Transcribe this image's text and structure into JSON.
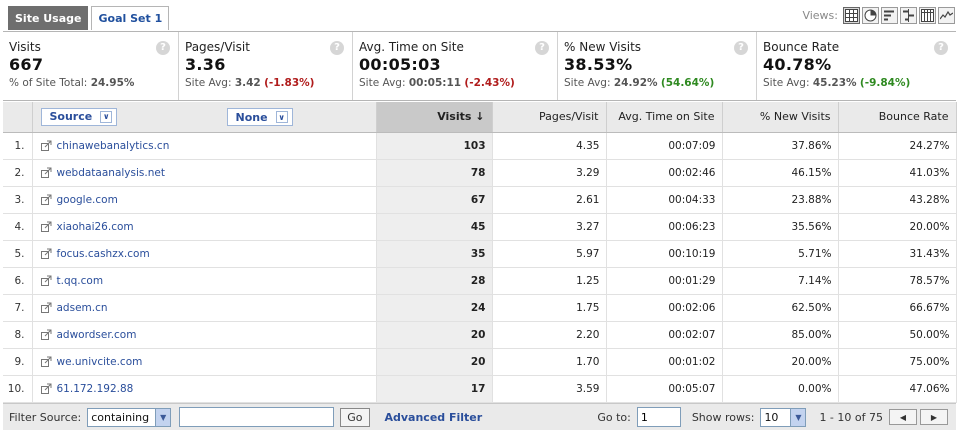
{
  "tabs": [
    {
      "label": "Site Usage",
      "active": true
    },
    {
      "label": "Goal Set 1",
      "active": false
    }
  ],
  "views": {
    "label": "Views:",
    "icons": [
      "table-view-icon",
      "pie-view-icon",
      "performance-view-icon",
      "comparison-view-icon",
      "pivot-view-icon",
      "sparkline-view-icon"
    ]
  },
  "summary": [
    {
      "title": "Visits",
      "value": "667",
      "sub_label": "% of Site Total:",
      "sub_value": "24.95%",
      "delta": ""
    },
    {
      "title": "Pages/Visit",
      "value": "3.36",
      "sub_label": "Site Avg:",
      "sub_value": "3.42",
      "delta": "(-1.83%)",
      "delta_type": "neg"
    },
    {
      "title": "Avg. Time on Site",
      "value": "00:05:03",
      "sub_label": "Site Avg:",
      "sub_value": "00:05:11",
      "delta": "(-2.43%)",
      "delta_type": "neg"
    },
    {
      "title": "% New Visits",
      "value": "38.53%",
      "sub_label": "Site Avg:",
      "sub_value": "24.92%",
      "delta": "(54.64%)",
      "delta_type": "pos"
    },
    {
      "title": "Bounce Rate",
      "value": "40.78%",
      "sub_label": "Site Avg:",
      "sub_value": "45.23%",
      "delta": "(-9.84%)",
      "delta_type": "pos"
    }
  ],
  "table": {
    "dimension_label": "Source",
    "secondary_label": "None",
    "columns": [
      "Visits",
      "Pages/Visit",
      "Avg. Time on Site",
      "% New Visits",
      "Bounce Rate"
    ],
    "rows": [
      {
        "idx": "1.",
        "source": "chinawebanalytics.cn",
        "visits": "103",
        "ppv": "4.35",
        "time": "00:07:09",
        "newv": "37.86%",
        "bounce": "24.27%"
      },
      {
        "idx": "2.",
        "source": "webdataanalysis.net",
        "visits": "78",
        "ppv": "3.29",
        "time": "00:02:46",
        "newv": "46.15%",
        "bounce": "41.03%"
      },
      {
        "idx": "3.",
        "source": "google.com",
        "visits": "67",
        "ppv": "2.61",
        "time": "00:04:33",
        "newv": "23.88%",
        "bounce": "43.28%"
      },
      {
        "idx": "4.",
        "source": "xiaohai26.com",
        "visits": "45",
        "ppv": "3.27",
        "time": "00:06:23",
        "newv": "35.56%",
        "bounce": "20.00%"
      },
      {
        "idx": "5.",
        "source": "focus.cashzx.com",
        "visits": "35",
        "ppv": "5.97",
        "time": "00:10:19",
        "newv": "5.71%",
        "bounce": "31.43%"
      },
      {
        "idx": "6.",
        "source": "t.qq.com",
        "visits": "28",
        "ppv": "1.25",
        "time": "00:01:29",
        "newv": "7.14%",
        "bounce": "78.57%"
      },
      {
        "idx": "7.",
        "source": "adsem.cn",
        "visits": "24",
        "ppv": "1.75",
        "time": "00:02:06",
        "newv": "62.50%",
        "bounce": "66.67%"
      },
      {
        "idx": "8.",
        "source": "adwordser.com",
        "visits": "20",
        "ppv": "2.20",
        "time": "00:02:07",
        "newv": "85.00%",
        "bounce": "50.00%"
      },
      {
        "idx": "9.",
        "source": "we.univcite.com",
        "visits": "20",
        "ppv": "1.70",
        "time": "00:01:02",
        "newv": "20.00%",
        "bounce": "75.00%"
      },
      {
        "idx": "10.",
        "source": "61.172.192.88",
        "visits": "17",
        "ppv": "3.59",
        "time": "00:05:07",
        "newv": "0.00%",
        "bounce": "47.06%"
      }
    ]
  },
  "footer": {
    "filter_label": "Filter Source:",
    "filter_mode": "containing",
    "filter_value": "",
    "go_label": "Go",
    "advanced_label": "Advanced Filter",
    "goto_label": "Go to:",
    "goto_value": "1",
    "show_rows_label": "Show rows:",
    "rows_value": "10",
    "range": "1 - 10 of 75"
  },
  "colors": {
    "link": "#2a4e9b",
    "negative": "#b01c1c",
    "positive": "#2f8a21",
    "active_tab": "#6e6e6e"
  }
}
